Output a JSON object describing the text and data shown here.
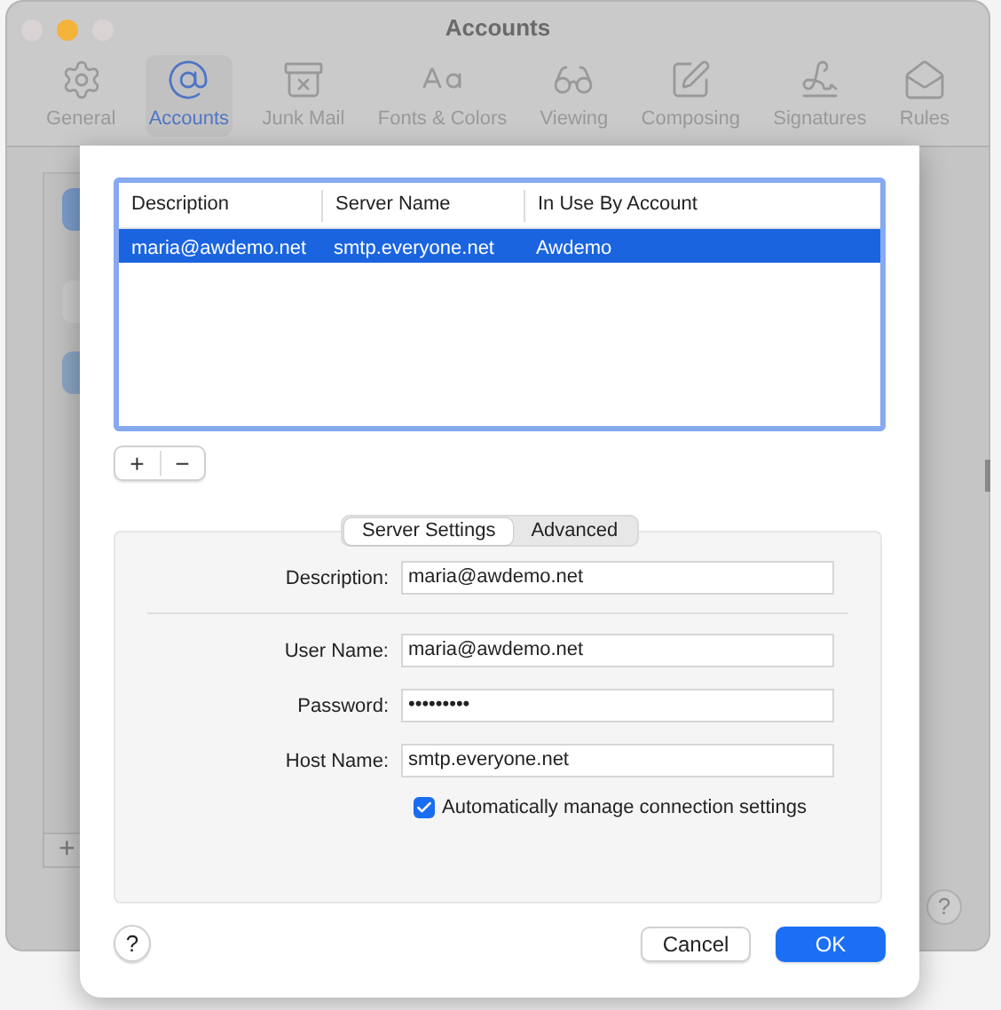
{
  "window": {
    "title": "Accounts"
  },
  "toolbar": [
    {
      "label": "General",
      "selected": false
    },
    {
      "label": "Accounts",
      "selected": true
    },
    {
      "label": "Junk Mail",
      "selected": false
    },
    {
      "label": "Fonts & Colors",
      "selected": false
    },
    {
      "label": "Viewing",
      "selected": false
    },
    {
      "label": "Composing",
      "selected": false
    },
    {
      "label": "Signatures",
      "selected": false
    },
    {
      "label": "Rules",
      "selected": false
    }
  ],
  "background": {
    "add_button": "+",
    "help_button": "?"
  },
  "sheet": {
    "table": {
      "columns": [
        "Description",
        "Server Name",
        "In Use By Account"
      ],
      "rows": [
        {
          "cells": [
            "maria@awdemo.net",
            "smtp.everyone.net",
            "Awdemo"
          ],
          "selected": true
        }
      ]
    },
    "list_buttons": [
      "+",
      "−"
    ],
    "tabs": [
      {
        "label": "Server Settings",
        "selected": true
      },
      {
        "label": "Advanced",
        "selected": false
      }
    ],
    "field_groups": [
      [
        {
          "label": "Description:",
          "value": "maria@awdemo.net"
        }
      ],
      [
        {
          "label": "User Name:",
          "value": "maria@awdemo.net"
        },
        {
          "label": "Password:",
          "value": "•••••••••"
        },
        {
          "label": "Host Name:",
          "value": "smtp.everyone.net"
        }
      ]
    ],
    "checkbox": {
      "label": "Automatically manage connection settings",
      "checked": true
    },
    "help_button": "?",
    "buttons": [
      {
        "label": "Cancel",
        "kind": "secondary"
      },
      {
        "label": "OK",
        "kind": "primary"
      }
    ]
  }
}
